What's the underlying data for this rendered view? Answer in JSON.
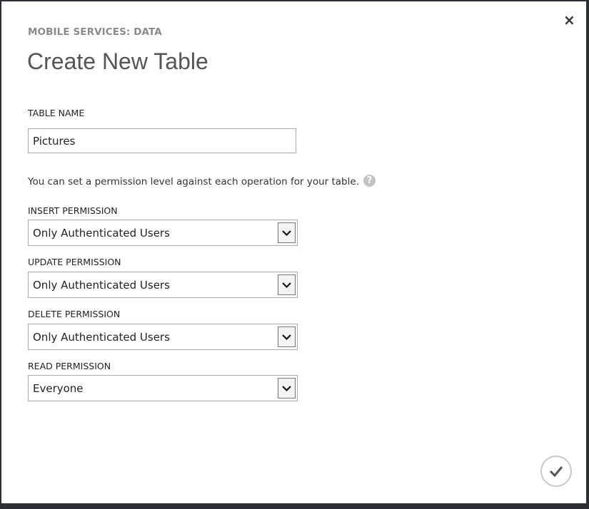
{
  "header": {
    "subtitle": "MOBILE SERVICES: DATA",
    "title": "Create New Table",
    "close": "×"
  },
  "table_name": {
    "label": "TABLE NAME",
    "value": "Pictures"
  },
  "description": "You can set a permission level against each operation for your table.",
  "help": "?",
  "permissions": [
    {
      "label": "INSERT PERMISSION",
      "value": "Only Authenticated Users"
    },
    {
      "label": "UPDATE PERMISSION",
      "value": "Only Authenticated Users"
    },
    {
      "label": "DELETE PERMISSION",
      "value": "Only Authenticated Users"
    },
    {
      "label": "READ PERMISSION",
      "value": "Everyone"
    }
  ]
}
